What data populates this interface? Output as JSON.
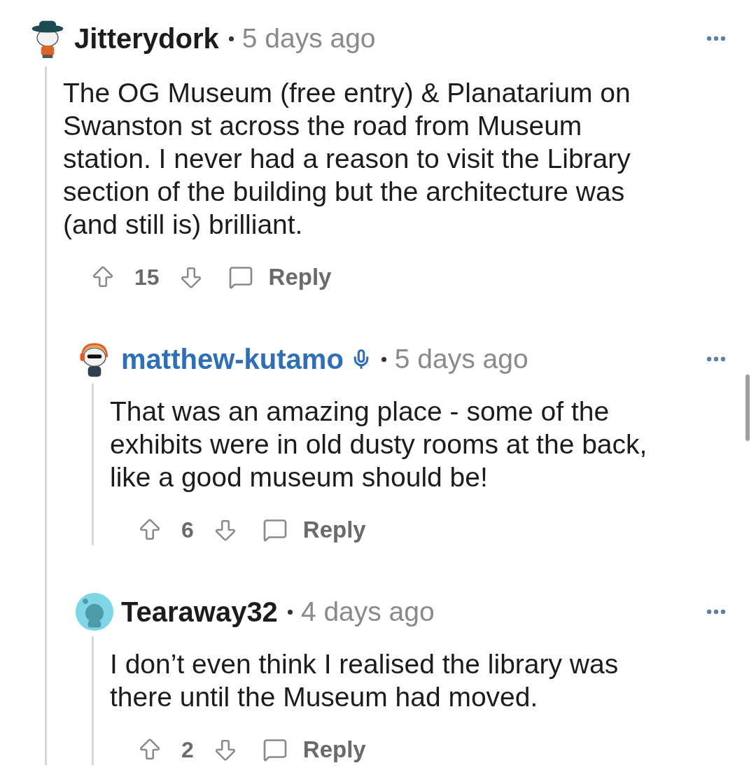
{
  "comments": [
    {
      "author": "Jitterydork",
      "color": "#1c1c1c",
      "kind": "hat",
      "mic_badge": false,
      "time": "5 days ago",
      "body": "The OG Museum (free entry) & Planatarium on Swanston st across the road from Museum station. I never had a reason to visit the Library section of the building but the architecture was (and still is) brilliant.",
      "votes": "15",
      "reply": "Reply",
      "children": [
        {
          "author": "matthew-kutamo",
          "color": "#2f6fb8",
          "kind": "headphones",
          "mic_badge": true,
          "time": "5 days ago",
          "body": "That was an amazing place - some of the exhibits were in old dusty rooms at the back, like a good museum should be!",
          "votes": "6",
          "reply": "Reply"
        },
        {
          "author": "Tearaway32",
          "color": "#1c1c1c",
          "kind": "default",
          "mic_badge": false,
          "time": "4 days ago",
          "body": "I don’t even think I realised the library was there until the Museum had moved.",
          "votes": "2",
          "reply": "Reply"
        }
      ]
    }
  ]
}
